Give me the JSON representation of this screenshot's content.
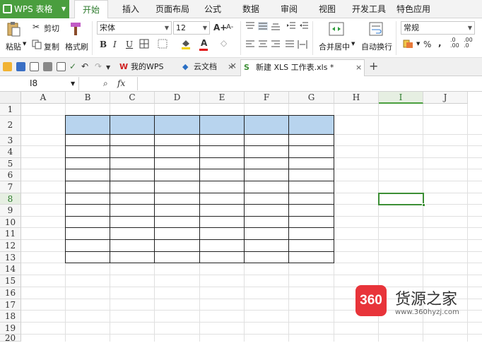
{
  "app": {
    "button_label": "WPS 表格"
  },
  "menu_tabs": [
    "开始",
    "插入",
    "页面布局",
    "公式",
    "数据",
    "审阅",
    "视图",
    "开发工具",
    "特色应用"
  ],
  "ribbon": {
    "paste": "粘贴",
    "cut": "剪切",
    "copy": "复制",
    "format_painter": "格式刷",
    "font_name": "宋体",
    "font_size": "12",
    "merge_center": "合并居中",
    "auto_wrap": "自动换行",
    "number_format": "常规",
    "percent": "%",
    "increase_font": "A+",
    "decrease_font": "A-",
    "bold": "B",
    "italic": "I",
    "underline": "U",
    "font_color": "A"
  },
  "doc_tabs": [
    {
      "label": "我的WPS"
    },
    {
      "label": "云文档"
    },
    {
      "label": "新建 XLS 工作表.xls *"
    }
  ],
  "formula_bar": {
    "cell_ref": "I8",
    "fx": "fx"
  },
  "grid": {
    "columns": [
      "A",
      "B",
      "C",
      "D",
      "E",
      "F",
      "G",
      "H",
      "I",
      "J"
    ],
    "rows": [
      "1",
      "2",
      "3",
      "4",
      "5",
      "6",
      "7",
      "8",
      "9",
      "10",
      "11",
      "12",
      "13",
      "14",
      "15",
      "16",
      "17",
      "18",
      "19",
      "20"
    ],
    "selected_column": "I",
    "selected_row": "8"
  },
  "colors": {
    "accent": "#4a9e3e",
    "table_header_fill": "#b8d4ee",
    "watermark_red": "#e8343a"
  },
  "watermark": {
    "badge": "360",
    "name": "货源之家",
    "url": "www.360hyzj.com"
  }
}
